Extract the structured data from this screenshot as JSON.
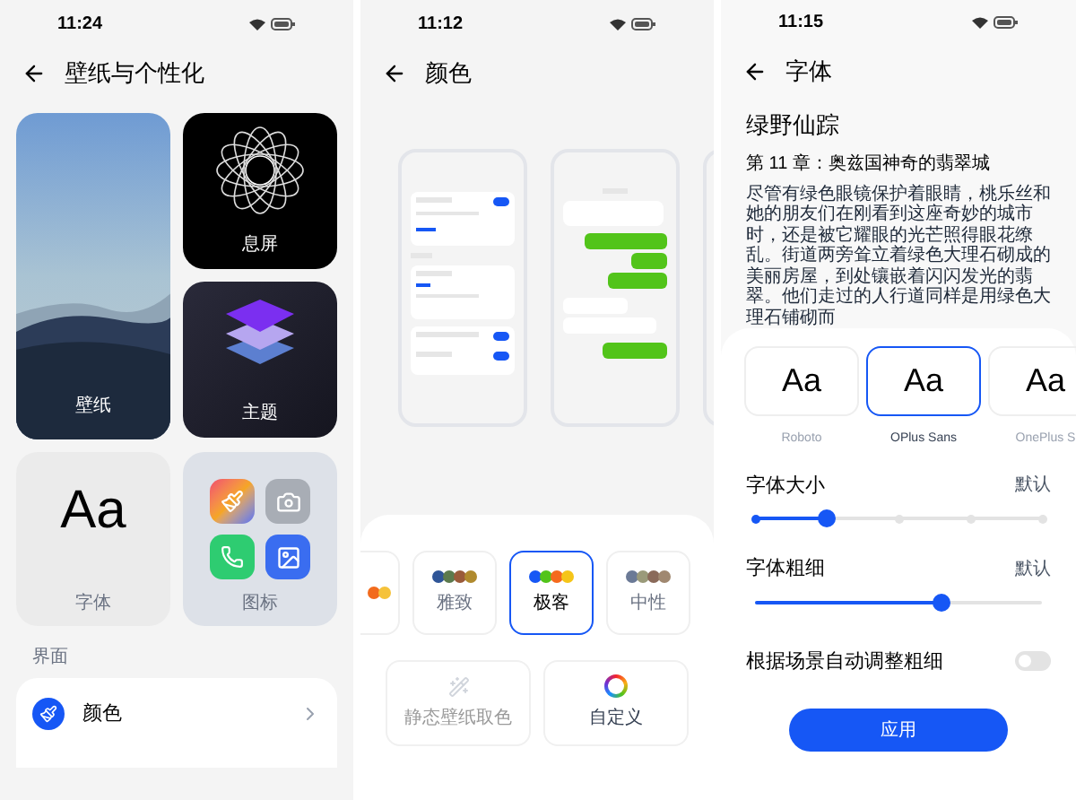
{
  "personalization": {
    "status_time": "11:24",
    "title": "壁纸与个性化",
    "tiles": [
      {
        "kind": "aod",
        "label": "息屏"
      },
      {
        "kind": "wallpaper",
        "label": "壁纸"
      },
      {
        "kind": "theme",
        "label": "主题"
      },
      {
        "kind": "font",
        "label": "字体",
        "sample": "Aa"
      },
      {
        "kind": "icons",
        "label": "图标"
      }
    ],
    "section": "界面",
    "items": [
      {
        "label": "颜色"
      }
    ]
  },
  "color": {
    "status_time": "11:12",
    "title": "颜色",
    "palettes": [
      {
        "selected": false,
        "swatches": [
          {
            "color": "#f26b1d"
          },
          {
            "color": "#f5c23a"
          }
        ]
      },
      {
        "label": "雅致",
        "selected": false,
        "swatches": [
          {
            "color": "#2f5597"
          },
          {
            "color": "#5c7a4d"
          },
          {
            "color": "#9a5b3a"
          },
          {
            "color": "#b08a2e"
          }
        ]
      },
      {
        "label": "极客",
        "selected": true,
        "swatches": [
          {
            "color": "#1657f5"
          },
          {
            "color": "#52c41a"
          },
          {
            "color": "#f56a1d"
          },
          {
            "color": "#f5c518"
          }
        ]
      },
      {
        "label": "中性",
        "selected": false,
        "swatches": [
          {
            "color": "#6b7a96"
          },
          {
            "color": "#9a9a7a"
          },
          {
            "color": "#8a6a5a"
          },
          {
            "color": "#a08870"
          }
        ]
      }
    ],
    "actions": [
      {
        "kind": "wand",
        "label": "静态壁纸取色",
        "disabled": true
      },
      {
        "kind": "ring",
        "label": "自定义",
        "disabled": false
      }
    ]
  },
  "font": {
    "status_time": "11:15",
    "title": "字体",
    "book_title": "绿野仙踪",
    "chapter": "第 11 章：奥兹国神奇的翡翠城",
    "paragraph": "尽管有绿色眼镜保护着眼睛，桃乐丝和她的朋友们在刚看到这座奇妙的城市时，还是被它耀眼的光芒照得眼花缭乱。街道两旁耸立着绿色大理石砌成的美丽房屋，到处镶嵌着闪闪发光的翡翠。他们走过的人行道同样是用绿色大理石铺砌而",
    "fonts": [
      {
        "name": "Roboto",
        "sample": "Aa",
        "selected": false
      },
      {
        "name": "OPlus Sans",
        "sample": "Aa",
        "selected": true
      },
      {
        "name": "OnePlus S",
        "sample": "Aa",
        "selected": false
      }
    ],
    "sliders": [
      {
        "kind": "stepped",
        "label": "字体大小",
        "value": "默认",
        "level": 0.25
      },
      {
        "kind": "continuous",
        "label": "字体粗细",
        "value": "默认",
        "level": 0.65
      }
    ],
    "toggle": {
      "label": "根据场景自动调整粗细",
      "on": false
    },
    "button": "应用"
  }
}
